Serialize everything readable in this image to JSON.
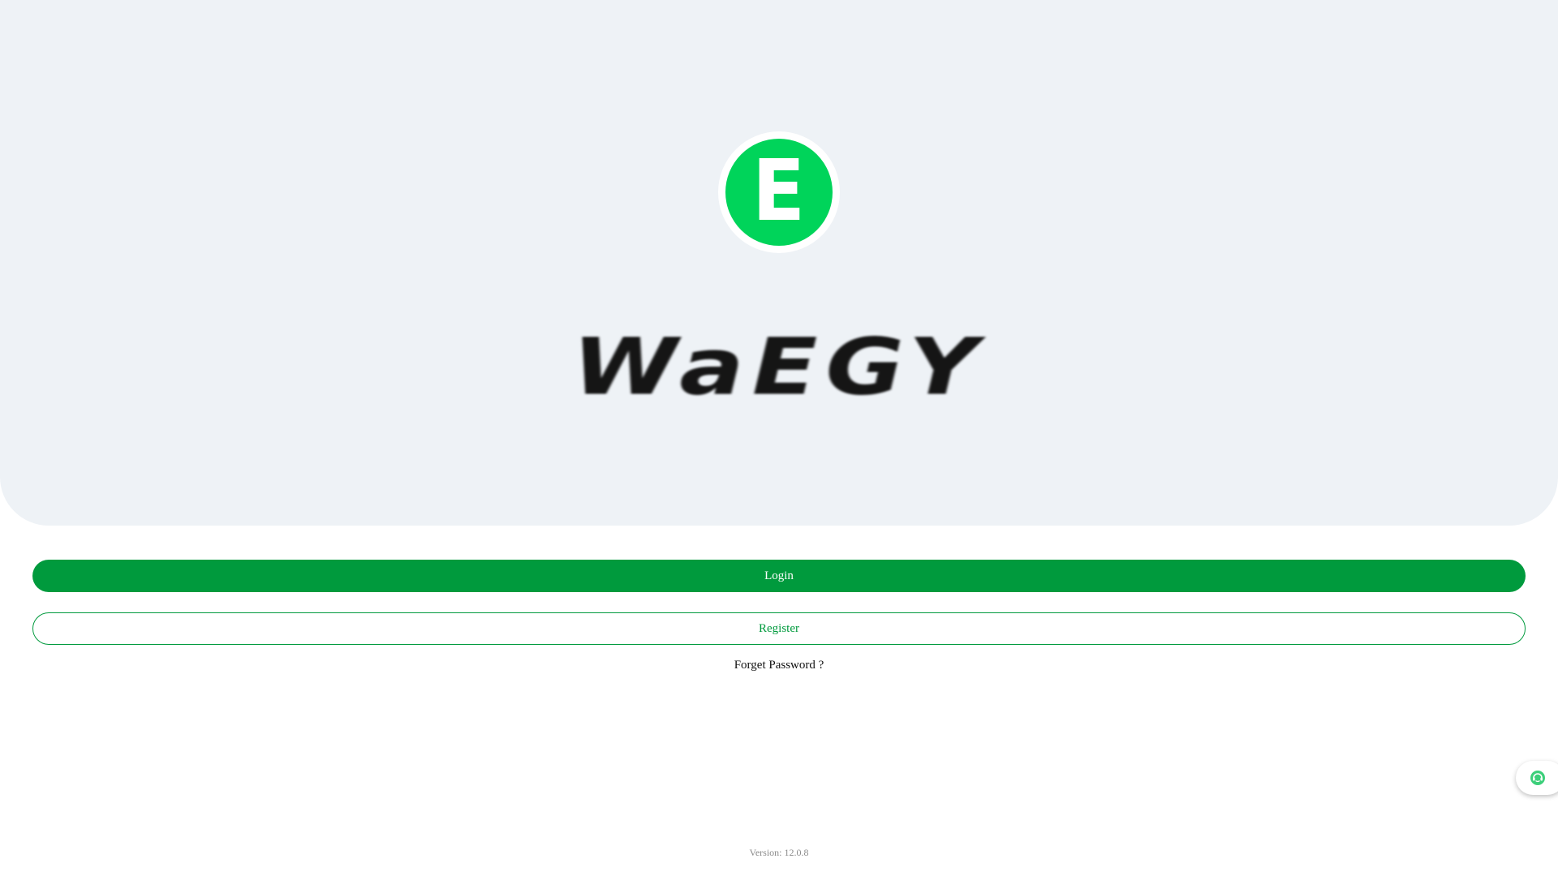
{
  "hero": {
    "logo_letter": "E",
    "brand_name": "WaEGY"
  },
  "actions": {
    "login_label": "Login",
    "register_label": "Register",
    "forget_password_label": "Forget Password ?"
  },
  "footer": {
    "version_text": "Version: 12.0.8"
  },
  "floating": {
    "support_icon": "customer-service-icon"
  },
  "colors": {
    "primary": "#009a3d",
    "logo_green": "#00d45a",
    "hero_background": "#eef2f6"
  }
}
